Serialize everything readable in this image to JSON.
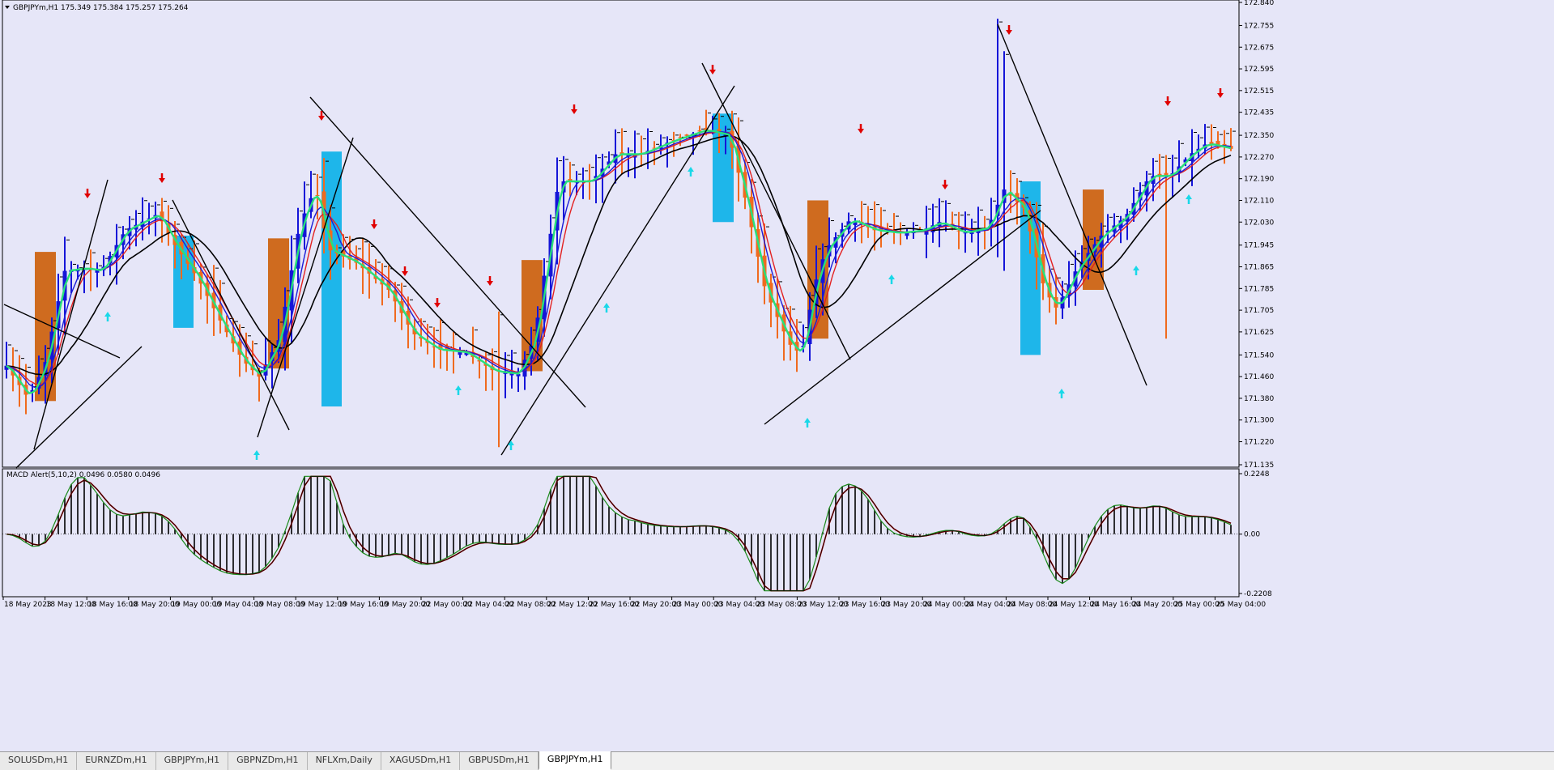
{
  "window": {
    "header": "GBPJPYm,H1  175.349 175.384 175.257 175.264",
    "indicator_label": "MACD Alert(5,10,2) 0.0496 0.0580 0.0496"
  },
  "colors": {
    "background": "#e6e6f8",
    "frame": "#000000",
    "bull": "#1515d8",
    "bear": "#f06a1f",
    "ma_fast": "#27e07a",
    "ma_mid": "#e32121",
    "ma_slow": "#000000",
    "ma_blue": "#1c1cd8",
    "box_orange": "#cf6b1f",
    "box_cyan": "#1eb6ea",
    "arrow_down": "#e00000",
    "arrow_up": "#19d8e8",
    "trendline": "#000000",
    "hist": "#000000",
    "macd_green": "#1a8a1a",
    "macd_red": "#e00000"
  },
  "price_axis": {
    "ticks": [
      "172.840",
      "172.755",
      "172.675",
      "172.595",
      "172.515",
      "172.435",
      "172.350",
      "172.270",
      "172.190",
      "172.110",
      "172.030",
      "171.945",
      "171.865",
      "171.785",
      "171.705",
      "171.625",
      "171.540",
      "171.460",
      "171.380",
      "171.300",
      "171.220",
      "171.135"
    ],
    "max": 172.84,
    "min": 171.135
  },
  "macd_axis": {
    "ticks": [
      "0.2248",
      "0.00",
      "-0.2208"
    ],
    "max": 0.2248,
    "min": -0.2208
  },
  "time_axis": {
    "labels": [
      "18 May 2023",
      "18 May 12:00",
      "18 May 16:00",
      "18 May 20:00",
      "19 May 00:00",
      "19 May 04:00",
      "19 May 08:00",
      "19 May 12:00",
      "19 May 16:00",
      "19 May 20:00",
      "22 May 00:00",
      "22 May 04:00",
      "22 May 08:00",
      "22 May 12:00",
      "22 May 16:00",
      "22 May 20:00",
      "23 May 00:00",
      "23 May 04:00",
      "23 May 08:00",
      "23 May 12:00",
      "23 May 16:00",
      "23 May 20:00",
      "24 May 00:00",
      "24 May 04:00",
      "24 May 08:00",
      "24 May 12:00",
      "24 May 16:00",
      "24 May 20:00",
      "25 May 00:00",
      "25 May 04:00"
    ]
  },
  "tabs": [
    "SOLUSDm,H1",
    "EURNZDm,H1",
    "GBPJPYm,H1",
    "GBPNZDm,H1",
    "NFLXm,Daily",
    "XAGUSDm,H1",
    "GBPUSDm,H1",
    "GBPJPYm,H1"
  ],
  "active_tab_index": 7,
  "chart_data": {
    "type": "candlestick",
    "symbol": "GBPJPYm",
    "timeframe": "H1",
    "open": 175.349,
    "high": 175.384,
    "low": 175.257,
    "close": 175.264,
    "macd": {
      "fast": 5,
      "slow": 10,
      "signal": 2,
      "values": [
        0.0496,
        0.058,
        0.0496
      ]
    }
  }
}
